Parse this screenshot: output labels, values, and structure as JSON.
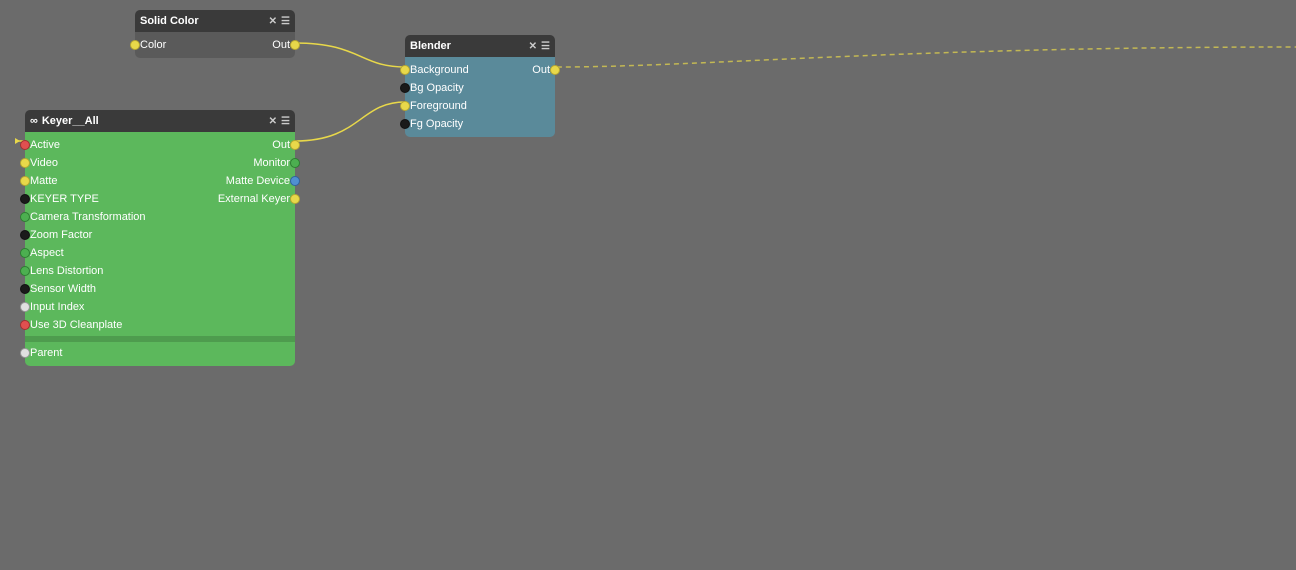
{
  "background_color": "#6b6b6b",
  "nodes": {
    "solid_color": {
      "title": "Solid Color",
      "inputs": [
        {
          "label": "Color",
          "port_color": "yellow",
          "port_side": "left"
        }
      ],
      "outputs": [
        {
          "label": "Out",
          "port_color": "yellow",
          "port_side": "right"
        }
      ]
    },
    "keyer": {
      "title": "Keyer__All",
      "inputs": [
        {
          "label": "Active",
          "port_color": "red"
        },
        {
          "label": "Video",
          "port_color": "yellow"
        },
        {
          "label": "Matte",
          "port_color": "yellow"
        },
        {
          "label": "KEYER TYPE",
          "port_color": "black"
        },
        {
          "label": "Camera Transformation",
          "port_color": "green"
        },
        {
          "label": "Zoom Factor",
          "port_color": "black"
        },
        {
          "label": "Aspect",
          "port_color": "green"
        },
        {
          "label": "Lens Distortion",
          "port_color": "green"
        },
        {
          "label": "Sensor Width",
          "port_color": "black"
        },
        {
          "label": "Input Index",
          "port_color": "white"
        },
        {
          "label": "Use 3D Cleanplate",
          "port_color": "red"
        },
        {
          "label": "Parent",
          "port_color": "white"
        }
      ],
      "outputs": [
        {
          "label": "Out",
          "port_color": "yellow",
          "row": 0
        },
        {
          "label": "Monitor",
          "port_color": "green",
          "row": 1
        },
        {
          "label": "Matte Device",
          "port_color": "blue",
          "row": 2
        },
        {
          "label": "External Keyer",
          "port_color": "yellow",
          "row": 3
        }
      ]
    },
    "blender": {
      "title": "Blender",
      "inputs": [
        {
          "label": "Background",
          "port_color": "yellow"
        },
        {
          "label": "Bg Opacity",
          "port_color": "black"
        },
        {
          "label": "Foreground",
          "port_color": "yellow"
        },
        {
          "label": "Fg Opacity",
          "port_color": "black"
        }
      ],
      "outputs": [
        {
          "label": "Out",
          "port_color": "yellow"
        }
      ]
    }
  },
  "icons": {
    "close": "✕",
    "menu": "☰",
    "link": "∞"
  }
}
